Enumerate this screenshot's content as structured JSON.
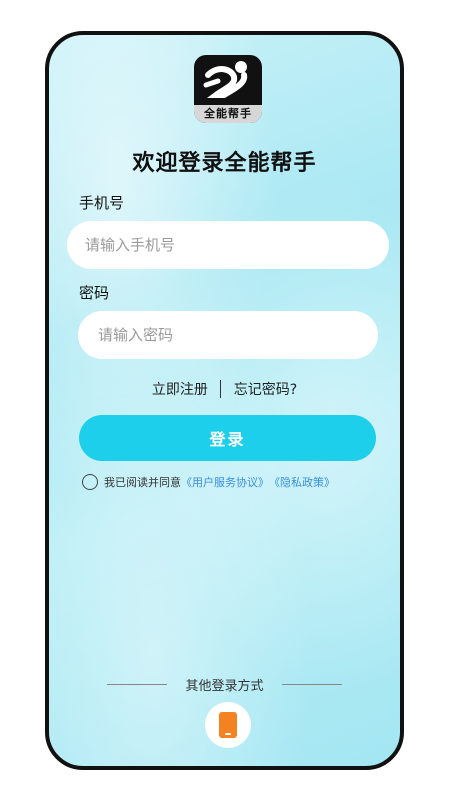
{
  "app": {
    "logo_text": "全能帮手",
    "title": "欢迎登录全能帮手"
  },
  "form": {
    "phone_label": "手机号",
    "phone_placeholder": "请输入手机号",
    "password_label": "密码",
    "password_placeholder": "请输入密码",
    "register_label": "立即注册",
    "forgot_label": "忘记密码?",
    "login_label": "登录"
  },
  "agreement": {
    "prefix": "我已阅读并同意",
    "user_agreement": "《用户服务协议》",
    "privacy_policy": "《隐私政策》"
  },
  "other_login": {
    "label": "其他登录方式",
    "options": [
      "phone-icon"
    ]
  },
  "colors": {
    "accent": "#1dcfea",
    "link": "#3a8fe0",
    "phone_icon": "#f58220"
  }
}
